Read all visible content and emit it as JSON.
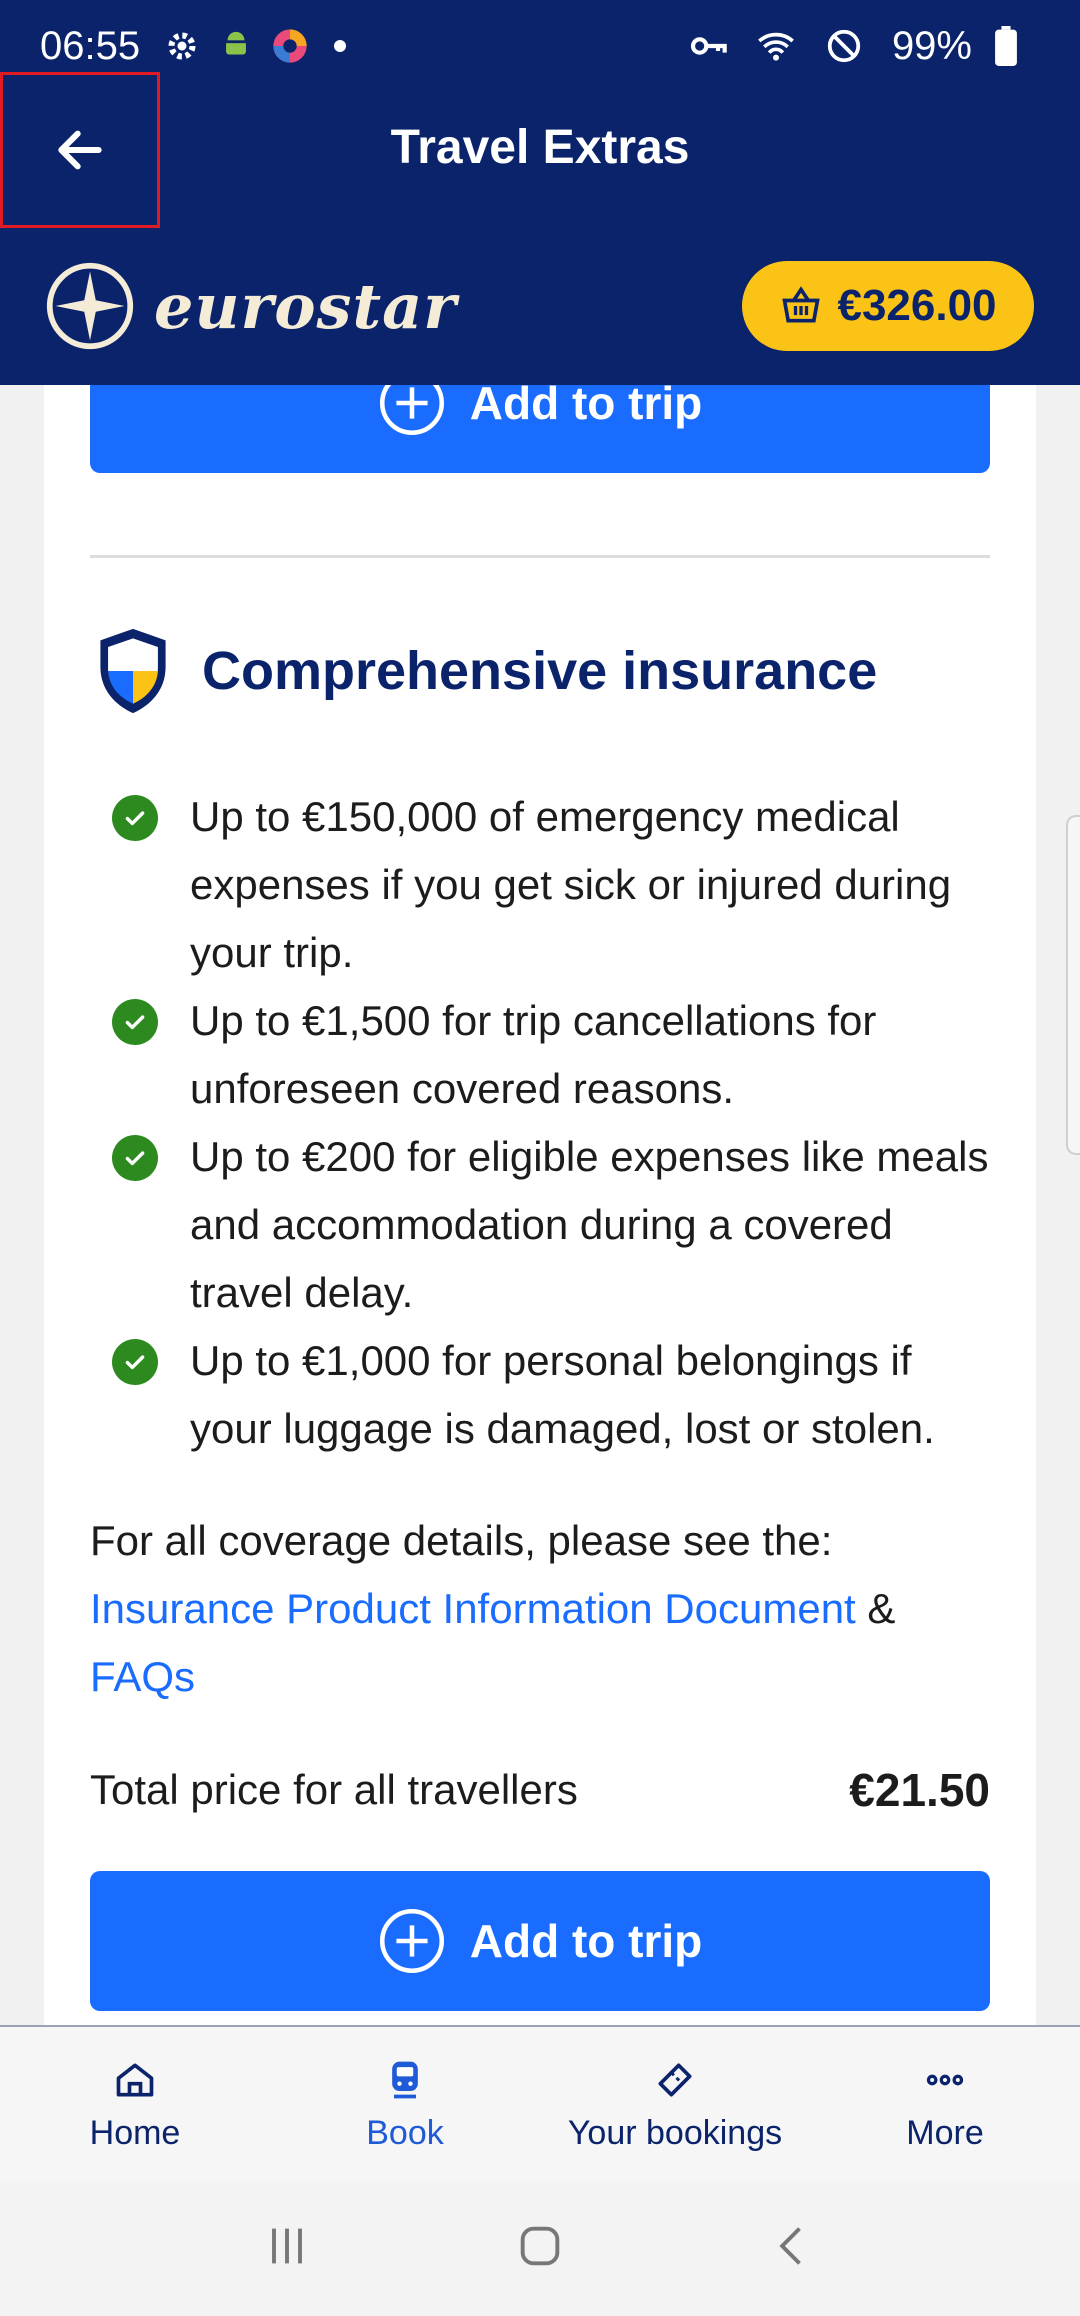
{
  "status_bar": {
    "time": "06:55",
    "battery": "99%"
  },
  "header": {
    "title": "Travel Extras",
    "brand": "eurostar",
    "basket_total": "€326.00"
  },
  "add_button_label": "Add to trip",
  "insurance": {
    "title": "Comprehensive insurance",
    "benefits": [
      "Up to €150,000 of emergency medical expenses if you get sick or injured during your trip.",
      "Up to €1,500 for trip cancellations for unforeseen covered reasons.",
      "Up to €200 for eligible expenses like meals and accommodation during a covered travel delay.",
      "Up to €1,000 for personal belongings if your luggage is damaged, lost or stolen."
    ],
    "coverage_intro": "For all coverage details, please see the:",
    "ipid_link": "Insurance Product Information Document",
    "ampersand": " & ",
    "faq_link": "FAQs",
    "total_label": "Total price for all travellers",
    "total_amount": "€21.50"
  },
  "bottom_nav": [
    {
      "label": "Home",
      "icon": "home-icon"
    },
    {
      "label": "Book",
      "icon": "train-icon"
    },
    {
      "label": "Your bookings",
      "icon": "ticket-icon"
    },
    {
      "label": "More",
      "icon": "more-dots-icon"
    }
  ],
  "colors": {
    "header_bg": "#0a236b",
    "primary_button": "#1a6cff",
    "basket_bg": "#fbc315",
    "check_green": "#2c8a1f"
  }
}
